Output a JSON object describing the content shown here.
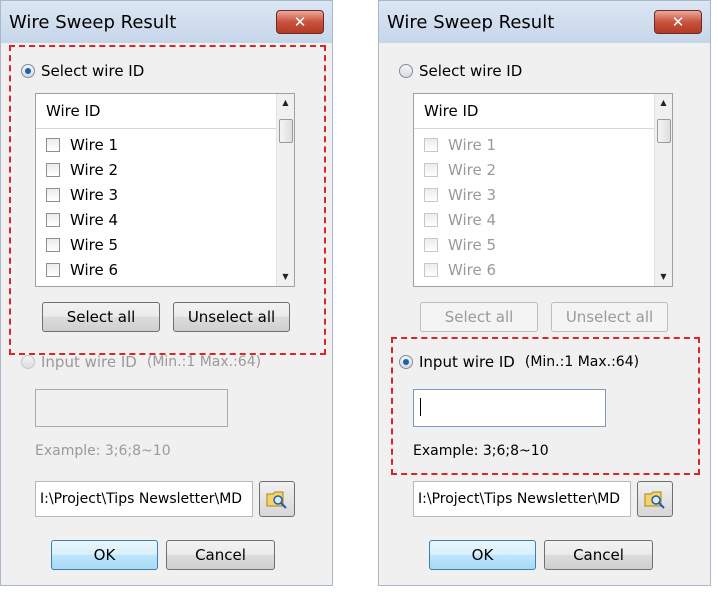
{
  "dialog_left": {
    "title": "Wire Sweep Result",
    "close_label": "✕",
    "select_wire_id_label": "Select wire ID",
    "list_header": "Wire ID",
    "items": [
      "Wire 1",
      "Wire 2",
      "Wire 3",
      "Wire 4",
      "Wire 5",
      "Wire 6"
    ],
    "select_all_label": "Select all",
    "unselect_all_label": "Unselect all",
    "input_wire_id_label": "Input wire ID",
    "range_hint": "(Min.:1 Max.:64)",
    "example_text": "Example: 3;6;8~10",
    "path_value": "I:\\Project\\Tips Newsletter\\MD",
    "ok_label": "OK",
    "cancel_label": "Cancel",
    "selected_mode": "select_wire_id"
  },
  "dialog_right": {
    "title": "Wire Sweep Result",
    "close_label": "✕",
    "select_wire_id_label": "Select wire ID",
    "list_header": "Wire ID",
    "items": [
      "Wire 1",
      "Wire 2",
      "Wire 3",
      "Wire 4",
      "Wire 5",
      "Wire 6"
    ],
    "select_all_label": "Select all",
    "unselect_all_label": "Unselect all",
    "input_wire_id_label": "Input wire ID",
    "range_hint": "(Min.:1 Max.:64)",
    "example_text": "Example: 3;6;8~10",
    "path_value": "I:\\Project\\Tips Newsletter\\MD",
    "ok_label": "OK",
    "cancel_label": "Cancel",
    "selected_mode": "input_wire_id"
  },
  "colors": {
    "highlight_box": "#d8262a",
    "radio_selected": "#1b5fb4",
    "disabled_text": "#9a9a9a"
  },
  "icons": {
    "browse": "folder-magnifier-icon",
    "close": "close-icon"
  }
}
